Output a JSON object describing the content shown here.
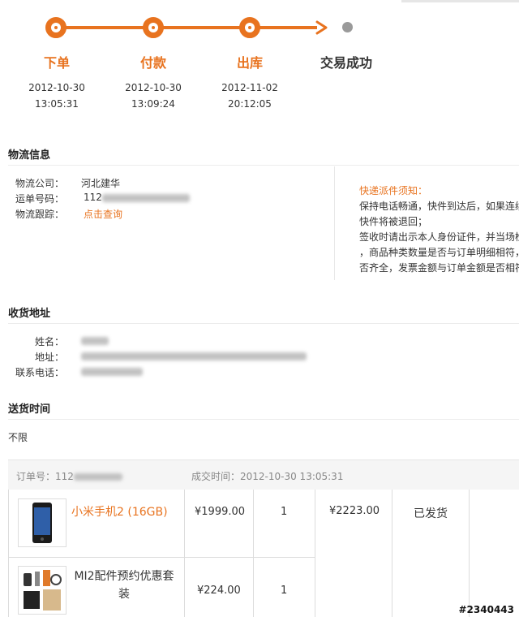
{
  "progress": {
    "steps": [
      {
        "label": "下单",
        "date": "2012-10-30",
        "time": "13:05:31"
      },
      {
        "label": "付款",
        "date": "2012-10-30",
        "time": "13:09:24"
      },
      {
        "label": "出库",
        "date": "2012-11-02",
        "time": "20:12:05"
      },
      {
        "label": "交易成功"
      }
    ],
    "accent": "#e8731f"
  },
  "logistics": {
    "title": "物流信息",
    "company_label": "物流公司：",
    "company_value": "河北建华",
    "waybill_label": "运单号码：",
    "waybill_prefix": "112",
    "tracking_label": "物流跟踪：",
    "tracking_link": "点击查询",
    "notice": {
      "title": "快递派件须知：",
      "lines": [
        "保持电话畅通，快件到达后，如果连续",
        "快件将被退回；",
        "签收时请出示本人身份证件，并当场检",
        "，商品种类数量是否与订单明细相符，",
        "否齐全，发票金额与订单金额是否相符"
      ]
    }
  },
  "address": {
    "title": "收货地址",
    "name_label": "姓名：",
    "addr_label": "地址：",
    "phone_label": "联系电话："
  },
  "delivery": {
    "title": "送货时间",
    "value": "不限"
  },
  "order": {
    "id_label": "订单号：",
    "id_prefix": "112",
    "deal_time": "成交时间：2012-10-30 13:05:31",
    "items": [
      {
        "name": "小米手机2 (16GB)",
        "price": "¥1999.00",
        "qty": "1"
      },
      {
        "name": "MI2配件预约优惠套装",
        "price": "¥224.00",
        "qty": "1"
      }
    ],
    "total": "¥2223.00",
    "status": "已发货"
  },
  "watermark": "#2340443"
}
